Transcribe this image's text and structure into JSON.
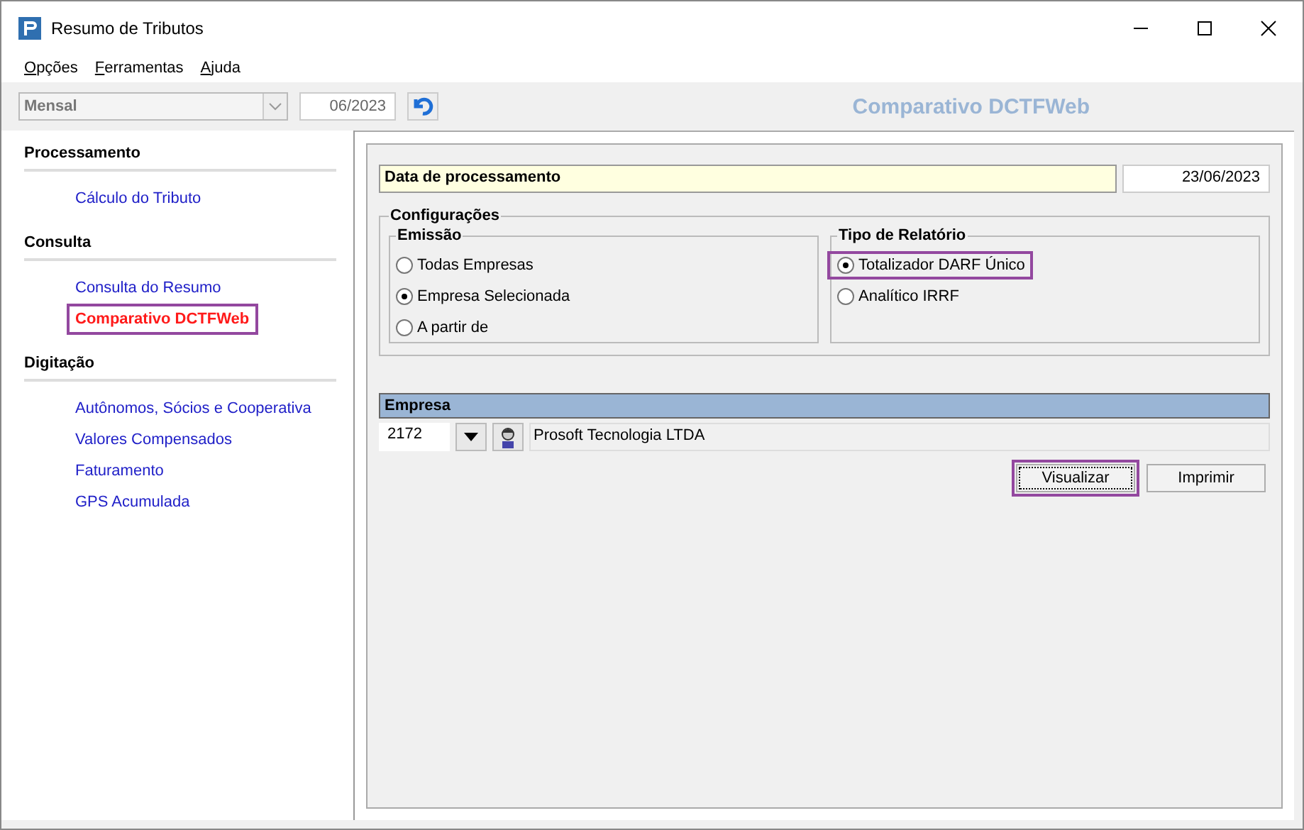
{
  "window": {
    "title": "Resumo de Tributos"
  },
  "menu": [
    "Opções",
    "Ferramentas",
    "Ajuda"
  ],
  "toolbar": {
    "period": "Mensal",
    "period_disabled": true,
    "date": "06/2023",
    "heading": "Comparativo DCTFWeb"
  },
  "sidebar": [
    {
      "title": "Processamento",
      "items": [
        {
          "label": "Cálculo do Tributo",
          "selected": false,
          "highlighted": false
        }
      ]
    },
    {
      "title": "Consulta",
      "items": [
        {
          "label": "Consulta do Resumo",
          "selected": false,
          "highlighted": false
        },
        {
          "label": "Comparativo DCTFWeb",
          "selected": true,
          "highlighted": true
        }
      ]
    },
    {
      "title": "Digitação",
      "items": [
        {
          "label": "Autônomos, Sócios e Cooperativa",
          "selected": false,
          "highlighted": false
        },
        {
          "label": "Valores Compensados",
          "selected": false,
          "highlighted": false
        },
        {
          "label": "Faturamento",
          "selected": false,
          "highlighted": false
        },
        {
          "label": "GPS Acumulada",
          "selected": false,
          "highlighted": false
        }
      ]
    }
  ],
  "processing": {
    "label": "Data de processamento",
    "value": "23/06/2023"
  },
  "config": {
    "title": "Configurações",
    "emissao": {
      "title": "Emissão",
      "options": [
        {
          "label": "Todas Empresas",
          "selected": false,
          "highlighted": false
        },
        {
          "label": "Empresa Selecionada",
          "selected": true,
          "highlighted": false
        },
        {
          "label": "A partir de",
          "selected": false,
          "highlighted": false
        }
      ]
    },
    "tipo": {
      "title": "Tipo de Relatório",
      "options": [
        {
          "label": "Totalizador DARF Único",
          "selected": true,
          "highlighted": true
        },
        {
          "label": "Analítico IRRF",
          "selected": false,
          "highlighted": false
        }
      ]
    }
  },
  "empresa": {
    "title": "Empresa",
    "code": "2172",
    "name": "Prosoft Tecnologia LTDA"
  },
  "buttons": [
    {
      "label": "Visualizar",
      "highlighted": true
    },
    {
      "label": "Imprimir",
      "highlighted": false
    }
  ]
}
